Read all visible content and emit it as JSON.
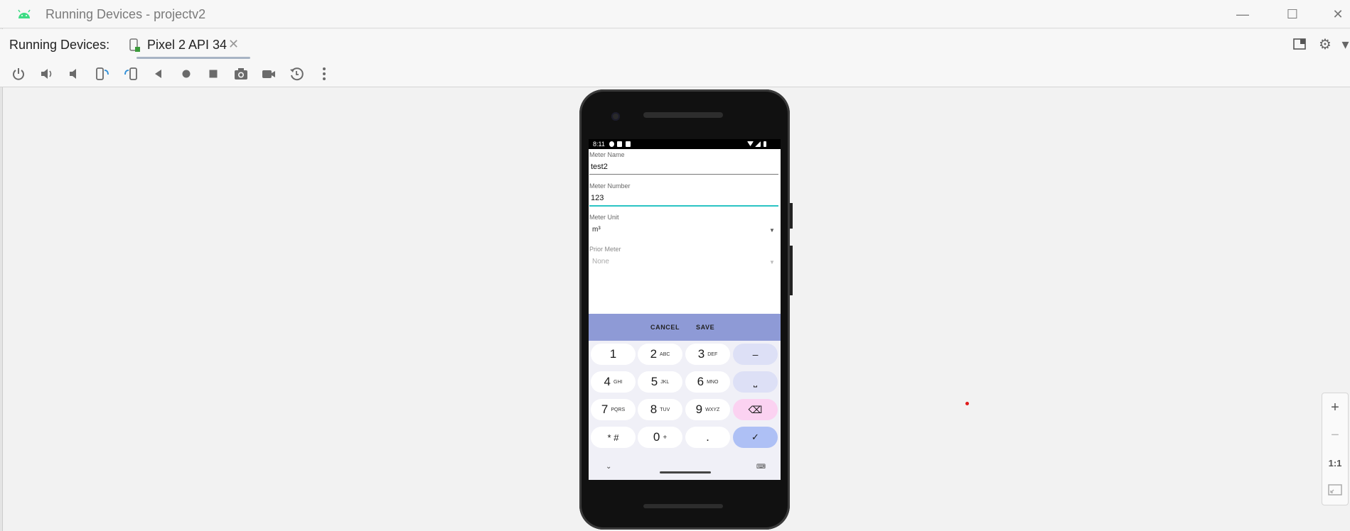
{
  "window": {
    "title": "Running Devices - projectv2"
  },
  "tabbar": {
    "label": "Running Devices:",
    "device_tab": "Pixel 2 API 34",
    "close_glyph": "✕"
  },
  "phone": {
    "status_time": "8:11",
    "form": {
      "name_label": "Meter Name",
      "name_value": "test2",
      "number_label": "Meter Number",
      "number_value": "123",
      "unit_label": "Meter Unit",
      "unit_value": "m³",
      "prior_label": "Prior Meter",
      "prior_value": "None"
    },
    "actions": {
      "cancel": "CANCEL",
      "save": "SAVE"
    },
    "keyboard": {
      "rows": [
        [
          {
            "n": "1",
            "s": ""
          },
          {
            "n": "2",
            "s": "ABC"
          },
          {
            "n": "3",
            "s": "DEF"
          },
          {
            "n": "–",
            "s": ""
          }
        ],
        [
          {
            "n": "4",
            "s": "GHI"
          },
          {
            "n": "5",
            "s": "JKL"
          },
          {
            "n": "6",
            "s": "MNO"
          },
          {
            "n": "⎵",
            "s": ""
          }
        ],
        [
          {
            "n": "7",
            "s": "PQRS"
          },
          {
            "n": "8",
            "s": "TUV"
          },
          {
            "n": "9",
            "s": "WXYZ"
          },
          {
            "n": "⌫",
            "s": ""
          }
        ],
        [
          {
            "n": "* #",
            "s": ""
          },
          {
            "n": "0",
            "s": "+"
          },
          {
            "n": ".",
            "s": ""
          },
          {
            "n": "✓",
            "s": ""
          }
        ]
      ]
    }
  },
  "zoom": {
    "plus": "+",
    "minus": "−",
    "actual": "1:1"
  },
  "colors": {
    "accent": "#2bc4c4",
    "action_bar": "#8e9ad6",
    "keyboard_bg": "#f0f0f7"
  }
}
